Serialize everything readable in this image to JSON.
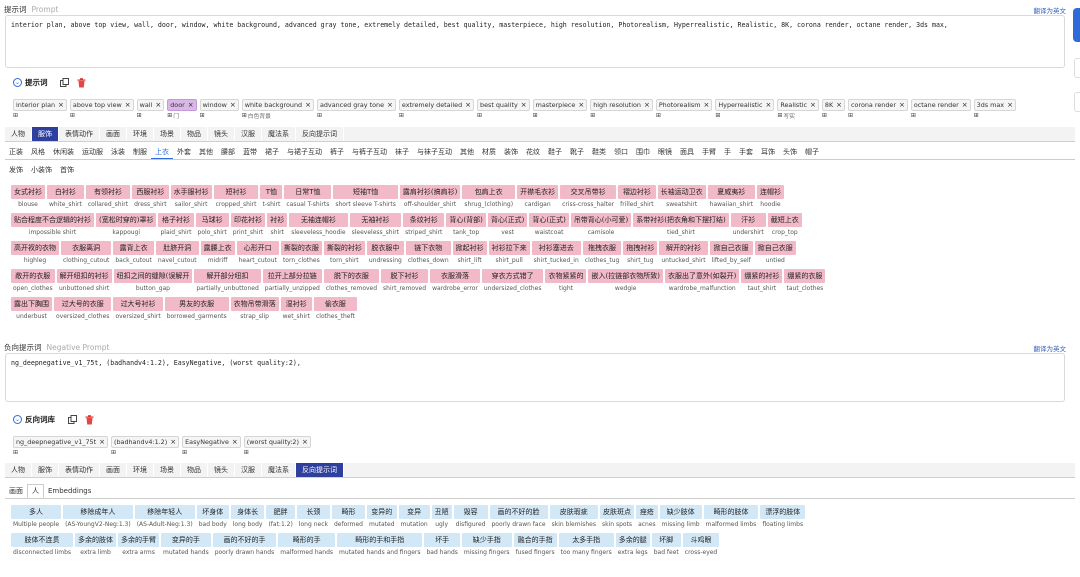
{
  "prompt_section": {
    "label": "提示词",
    "sub_label": "Prompt",
    "translate_link": "翻译为英文",
    "text": "interior plan, above top view, wall, door, window, white background, advanced gray tone, extremely detailed, best quality, masterpiece, high resolution, Photorealism, Hyperrealistic, Realistic, 8K, corona render, octane render, 3ds max,"
  },
  "prompt_lib": {
    "title": "提示词",
    "tokens": [
      {
        "label": "interior plan",
        "cn": ""
      },
      {
        "label": "above top view",
        "cn": ""
      },
      {
        "label": "wall",
        "cn": ""
      },
      {
        "label": "door",
        "cn": "门",
        "selected": true
      },
      {
        "label": "window",
        "cn": ""
      },
      {
        "label": "white background",
        "cn": "白色背景"
      },
      {
        "label": "advanced gray tone",
        "cn": ""
      },
      {
        "label": "extremely detailed",
        "cn": ""
      },
      {
        "label": "best quality",
        "cn": ""
      },
      {
        "label": "masterpiece",
        "cn": ""
      },
      {
        "label": "high resolution",
        "cn": ""
      },
      {
        "label": "Photorealism",
        "cn": ""
      },
      {
        "label": "Hyperrealistic",
        "cn": ""
      },
      {
        "label": "Realistic",
        "cn": "写实"
      },
      {
        "label": "8K",
        "cn": ""
      },
      {
        "label": "corona render",
        "cn": ""
      },
      {
        "label": "octane render",
        "cn": ""
      },
      {
        "label": "3ds max",
        "cn": ""
      }
    ],
    "main_tabs": [
      "人物",
      "服饰",
      "表情动作",
      "画面",
      "环境",
      "场景",
      "物品",
      "镜头",
      "汉服",
      "魔法系",
      "反向提示词"
    ],
    "active_main_tab": 1,
    "sub_tabs_row1": [
      "正装",
      "风格",
      "休闲装",
      "运动服",
      "泳装",
      "制服",
      "上衣",
      "外套",
      "其他",
      "腰部",
      "蓝带",
      "裙子",
      "与裙子互动",
      "裤子",
      "与裤子互动",
      "袜子",
      "与袜子互动",
      "其他",
      "材质",
      "装饰",
      "花纹",
      "鞋子",
      "靴子",
      "鞋类",
      "领口",
      "围巾",
      "眼镜",
      "面具",
      "手臂",
      "手",
      "手套",
      "耳饰",
      "头饰",
      "帽子"
    ],
    "active_sub_tab": 6,
    "sub_tabs_row2": [
      "发饰",
      "小装饰",
      "首饰"
    ],
    "tags": [
      [
        "女式衬衫",
        "blouse"
      ],
      [
        "白衬衫",
        "white_shirt"
      ],
      [
        "有领衬衫",
        "collared_shirt"
      ],
      [
        "西服衬衫",
        "dress_shirt"
      ],
      [
        "水手服衬衫",
        "sailor_shirt"
      ],
      [
        "短衬衫",
        "cropped_shirt"
      ],
      [
        "T恤",
        "t-shirt"
      ],
      [
        "日常T恤",
        "casual T-shirts"
      ],
      [
        "短袖T恤",
        "short sleeve T-shirts"
      ],
      [
        "露肩衬衫(搞肩衫)",
        "off-shoulder_shirt"
      ],
      [
        "包肩上衣",
        "shrug_(clothing)"
      ],
      [
        "开襟毛衣衫",
        "cardigan"
      ],
      [
        "交叉吊带衫",
        "criss-cross_halter"
      ],
      [
        "褶边衬衫",
        "frilled_shirt"
      ],
      [
        "长袖运动卫衣",
        "sweatshirt"
      ],
      [
        "夏威夷衫",
        "hawaiian_shirt"
      ],
      [
        "连帽衫",
        "hoodie"
      ],
      [
        "贴合程度不合逻辑的衬衫",
        "impossible shirt"
      ],
      [
        "(宽松时穿的)罩衫",
        "kappougi"
      ],
      [
        "格子衬衫",
        "plaid_shirt"
      ],
      [
        "马球衫",
        "polo_shirt"
      ],
      [
        "印花衬衫",
        "print_shirt"
      ],
      [
        "衬衫",
        "shirt"
      ],
      [
        "无袖连帽衫",
        "sleeveless_hoodie"
      ],
      [
        "无袖衬衫",
        "sleeveless_shirt"
      ],
      [
        "条纹衬衫",
        "striped_shirt"
      ],
      [
        "背心(背部)",
        "tank_top"
      ],
      [
        "背心(正式)",
        "vest"
      ],
      [
        "背心(正式)",
        "waistcoat"
      ],
      [
        "吊带背心(小可爱)",
        "camisole"
      ],
      [
        "系带衬衫(把衣角和下摆打结)",
        "tied_shirt"
      ],
      [
        "汗衫",
        "undershirt"
      ],
      [
        "截短上衣",
        "crop_top"
      ],
      [
        "高开衩的衣物",
        "highleg"
      ],
      [
        "衣服离洞",
        "clothing_cutout"
      ],
      [
        "露背上衣",
        "back_cutout"
      ],
      [
        "肚脐开洞",
        "navel_cutout"
      ],
      [
        "露腰上衣",
        "midriff"
      ],
      [
        "心形开口",
        "heart_cutout"
      ],
      [
        "撕裂的衣服",
        "torn_clothes"
      ],
      [
        "撕裂的衬衫",
        "torn_shirt"
      ],
      [
        "脱衣服中",
        "undressing"
      ],
      [
        "链下衣物",
        "clothes_down"
      ],
      [
        "掀起衬衫",
        "shirt_lift"
      ],
      [
        "衬衫拉下来",
        "shirt_pull"
      ],
      [
        "衬衫塞进去",
        "shirt_tucked_in"
      ],
      [
        "拖拽衣服",
        "clothes_tug"
      ],
      [
        "拖拽衬衫",
        "shirt_tug"
      ],
      [
        "解开的衬衫",
        "untucked_shirt"
      ],
      [
        "掀自己衣服",
        "lifted_by_self"
      ],
      [
        "掀自己衣服",
        "untied"
      ],
      [
        "敞开的衣服",
        "open_clothes"
      ],
      [
        "解开纽扣的衬衫",
        "unbuttoned shirt"
      ],
      [
        "纽扣之间的缝隙(误解开",
        "button_gap"
      ],
      [
        "解开部分纽扣",
        "partially_unbuttoned"
      ],
      [
        "拉开上部分拉链",
        "partially_unzipped"
      ],
      [
        "脱下的衣服",
        "clothes_removed"
      ],
      [
        "脱下衬衫",
        "shirt_removed"
      ],
      [
        "衣服滑落",
        "wardrobe_error"
      ],
      [
        "穿衣方式错了",
        "undersized_clothes"
      ],
      [
        "衣物紧紧的",
        "tight"
      ],
      [
        "嵌入(拉链部衣物所致)",
        "wedgie"
      ],
      [
        "衣服出了意外(如裂开)",
        "wardrobe_malfunction"
      ],
      [
        "绷紧的衬衫",
        "taut_shirt"
      ],
      [
        "绷紧的衣服",
        "taut_clothes"
      ],
      [
        "露出下胸围",
        "underbust"
      ],
      [
        "过大号的衣服",
        "oversized_clothes"
      ],
      [
        "过大号衬衫",
        "oversized_shirt"
      ],
      [
        "男友的衣服",
        "borrowed_garments"
      ],
      [
        "衣物吊带滑落",
        "strap_slip"
      ],
      [
        "湿衬衫",
        "wet_shirt"
      ],
      [
        "偷衣服",
        "clothes_theft"
      ]
    ],
    "tag_rows": [
      17,
      16,
      18,
      14,
      7
    ]
  },
  "negative_section": {
    "label": "负向提示词",
    "sub_label": "Negative Prompt",
    "translate_link": "翻译为英文",
    "text": "ng_deepnegative_v1_75t, (badhandv4:1.2), EasyNegative, (worst quality:2),"
  },
  "negative_lib": {
    "title": "反向词库",
    "tokens": [
      {
        "label": "ng_deepnegative_v1_75t"
      },
      {
        "label": "(badhandv4:1.2)"
      },
      {
        "label": "EasyNegative"
      },
      {
        "label": "(worst quality:2)"
      }
    ],
    "main_tabs": [
      "人物",
      "服饰",
      "表情动作",
      "画面",
      "环境",
      "场景",
      "物品",
      "镜头",
      "汉服",
      "魔法系",
      "反向提示词"
    ],
    "active_main_tab": 10,
    "sub_tabs": [
      "画面",
      "人",
      "Embeddings"
    ],
    "active_sub_tab": 1,
    "tags": [
      [
        "多人",
        "Multiple people"
      ],
      [
        "移除成年人",
        "(AS-YoungV2-Neg:1.3)"
      ],
      [
        "移除年轻人",
        "(AS-Adult-Neg:1.3)"
      ],
      [
        "坏身体",
        "bad body"
      ],
      [
        "身体长",
        "long body"
      ],
      [
        "肥胖",
        "(fat:1.2)"
      ],
      [
        "长颈",
        "long neck"
      ],
      [
        "畸形",
        "deformed"
      ],
      [
        "变异的",
        "mutated"
      ],
      [
        "变异",
        "mutation"
      ],
      [
        "丑陋",
        "ugly"
      ],
      [
        "毁容",
        "disfigured"
      ],
      [
        "画的不好的脸",
        "poorly drawn face"
      ],
      [
        "皮肤瑕疵",
        "skin blemishes"
      ],
      [
        "皮肤斑点",
        "skin spots"
      ],
      [
        "痤疮",
        "acnes"
      ],
      [
        "缺少肢体",
        "missing limb"
      ],
      [
        "畸形的肢体",
        "malformed limbs"
      ],
      [
        "漂浮的肢体",
        "floating limbs"
      ],
      [
        "肢体不连贯",
        "disconnected limbs"
      ],
      [
        "多余的肢体",
        "extra limb"
      ],
      [
        "多余的手臂",
        "extra arms"
      ],
      [
        "变异的手",
        "mutated hands"
      ],
      [
        "画的不好的手",
        "poorly drawn hands"
      ],
      [
        "畸形的手",
        "malformed hands"
      ],
      [
        "畸形的手和手指",
        "mutated hands and fingers"
      ],
      [
        "坏手",
        "bad hands"
      ],
      [
        "缺少手指",
        "missing fingers"
      ],
      [
        "融合的手指",
        "fused fingers"
      ],
      [
        "太多手指",
        "too many fingers"
      ],
      [
        "多余的腿",
        "extra legs"
      ],
      [
        "坏脚",
        "bad feet"
      ],
      [
        "斗鸡眼",
        "cross-eyed"
      ]
    ],
    "tag_rows": [
      19,
      14
    ]
  },
  "icons": {
    "copy": "copy-icon",
    "delete": "trash-icon",
    "grid": "grid-icon",
    "close": "close-icon",
    "toggle": "chevron-circle-icon"
  },
  "colors": {
    "accent": "#2e3f9e",
    "pink_tag": "#f2b9c9",
    "blue_tag": "#d3e8f7",
    "selected_chip": "#d9b8e8"
  }
}
